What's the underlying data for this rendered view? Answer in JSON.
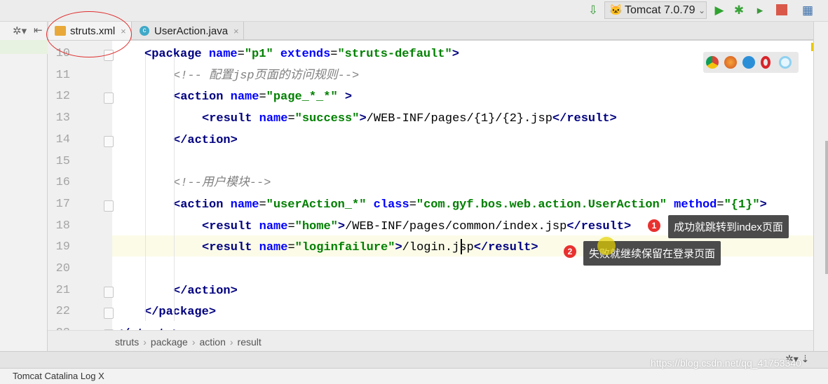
{
  "toolbar": {
    "run_config": "Tomcat 7.0.79",
    "icons": [
      "sort-icon",
      "tomcat-icon",
      "run-icon",
      "debug-icon",
      "coverage-icon",
      "stop-icon",
      "project-structure-icon"
    ]
  },
  "left_panel": {
    "icons": [
      "settings-icon",
      "collapse-icon"
    ]
  },
  "tabs": [
    {
      "label": "struts.xml",
      "close": "×",
      "active": true
    },
    {
      "label": "UserAction.java",
      "close": "×",
      "active": false
    }
  ],
  "browsers": [
    "chrome",
    "firefox",
    "safari",
    "opera",
    "ie"
  ],
  "code": {
    "lines": [
      {
        "n": "10",
        "indent": 1,
        "tokens": [
          [
            "tag",
            "<package "
          ],
          [
            "attr",
            "name"
          ],
          [
            "txt",
            "="
          ],
          [
            "val",
            "\"p1\" "
          ],
          [
            "attr",
            "extends"
          ],
          [
            "txt",
            "="
          ],
          [
            "val",
            "\"struts-default\""
          ],
          [
            "tag",
            ">"
          ]
        ]
      },
      {
        "n": "11",
        "indent": 2,
        "tokens": [
          [
            "cmt",
            "<!-- 配置jsp页面的访问规则-->"
          ]
        ]
      },
      {
        "n": "12",
        "indent": 2,
        "tokens": [
          [
            "tag",
            "<action "
          ],
          [
            "attr",
            "name"
          ],
          [
            "txt",
            "="
          ],
          [
            "val",
            "\"page_*_*\" "
          ],
          [
            "tag",
            ">"
          ]
        ]
      },
      {
        "n": "13",
        "indent": 3,
        "tokens": [
          [
            "tag",
            "<result "
          ],
          [
            "attr",
            "name"
          ],
          [
            "txt",
            "="
          ],
          [
            "val",
            "\"success\""
          ],
          [
            "tag",
            ">"
          ],
          [
            "txt",
            "/WEB-INF/pages/{1}/{2}.jsp"
          ],
          [
            "tag",
            "</result>"
          ]
        ]
      },
      {
        "n": "14",
        "indent": 2,
        "tokens": [
          [
            "tag",
            "</action>"
          ]
        ]
      },
      {
        "n": "15",
        "indent": 0,
        "tokens": []
      },
      {
        "n": "16",
        "indent": 2,
        "tokens": [
          [
            "cmt",
            "<!--用户模块-->"
          ]
        ]
      },
      {
        "n": "17",
        "indent": 2,
        "tokens": [
          [
            "tag",
            "<action "
          ],
          [
            "attr",
            "name"
          ],
          [
            "txt",
            "="
          ],
          [
            "val",
            "\"userAction_*\" "
          ],
          [
            "attr",
            "class"
          ],
          [
            "txt",
            "="
          ],
          [
            "val",
            "\"com.gyf.bos.web.action.UserAction\" "
          ],
          [
            "attr",
            "method"
          ],
          [
            "txt",
            "="
          ],
          [
            "val",
            "\"{1}\""
          ],
          [
            "tag",
            ">"
          ]
        ]
      },
      {
        "n": "18",
        "indent": 3,
        "tokens": [
          [
            "tag",
            "<result "
          ],
          [
            "attr",
            "name"
          ],
          [
            "txt",
            "="
          ],
          [
            "val",
            "\"home\""
          ],
          [
            "tag",
            ">"
          ],
          [
            "txt",
            "/WEB-INF/pages/common/index.jsp"
          ],
          [
            "tag",
            "</result>"
          ]
        ]
      },
      {
        "n": "19",
        "indent": 3,
        "tokens": [
          [
            "tag",
            "<result "
          ],
          [
            "attr",
            "name"
          ],
          [
            "txt",
            "="
          ],
          [
            "val",
            "\"loginfailure\""
          ],
          [
            "tag",
            ">"
          ],
          [
            "txt",
            "/login.jsp"
          ],
          [
            "tag",
            "</result>"
          ]
        ]
      },
      {
        "n": "20",
        "indent": 0,
        "tokens": []
      },
      {
        "n": "21",
        "indent": 2,
        "tokens": [
          [
            "tag",
            "</action>"
          ]
        ]
      },
      {
        "n": "22",
        "indent": 1,
        "tokens": [
          [
            "tag",
            "</package>"
          ]
        ]
      },
      {
        "n": "23",
        "indent": 0,
        "tokens": [
          [
            "tag",
            "</struts>"
          ]
        ]
      }
    ]
  },
  "annotations": [
    {
      "number": "1",
      "text": "成功就跳转到index页面"
    },
    {
      "number": "2",
      "text": "失败就继续保留在登录页面"
    }
  ],
  "breadcrumb": [
    "struts",
    "package",
    "action",
    "result"
  ],
  "bottom": {
    "tab_label": "Tomcat Catalina Log",
    "close": "X"
  },
  "watermark": "https://blog.csdn.net/qq_41753340",
  "colors": {
    "tag": "#000080",
    "attr": "#0000ff",
    "value": "#008000",
    "comment": "#808080",
    "badge": "#e8312f",
    "highlight_circle": "#e03030"
  }
}
